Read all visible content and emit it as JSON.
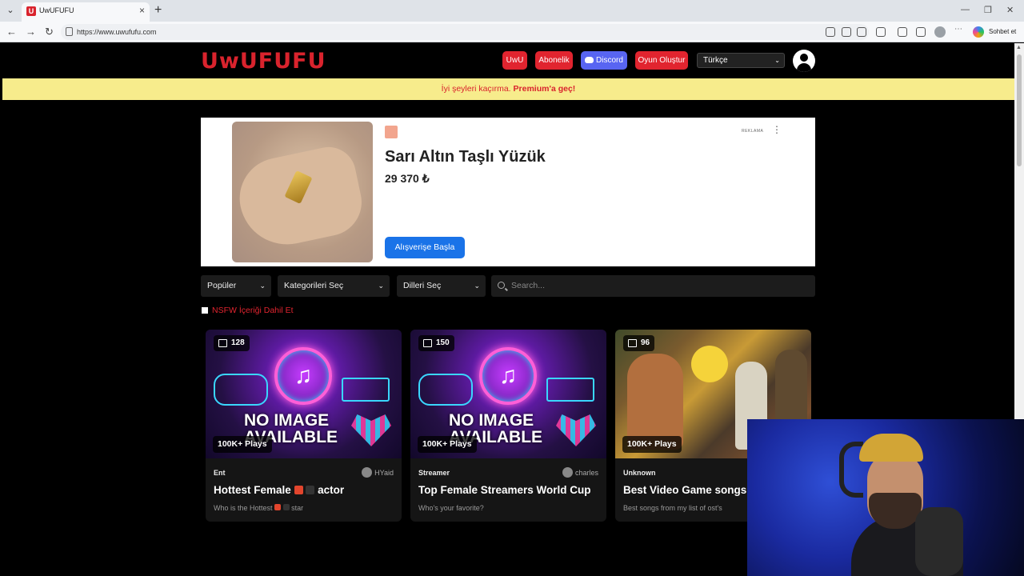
{
  "browser": {
    "tab_title": "UwUFUFU",
    "tab_favicon_letter": "U",
    "url": "https://www.uwufufu.com",
    "copilot_label": "Sohbet et"
  },
  "header": {
    "logo": "UwUFUFU",
    "buttons": {
      "uwu": "UwU",
      "subscription": "Abonelik",
      "discord": "Discord",
      "create_game": "Oyun Oluştur"
    },
    "language": "Türkçe"
  },
  "promo": {
    "text": "İyi şeyleri kaçırma.",
    "link": "Premium'a geç!"
  },
  "ad": {
    "label": "REKLAMA",
    "title": "Sarı Altın Taşlı Yüzük",
    "price": "29 370 ₺",
    "cta": "Alışverişe Başla"
  },
  "filters": {
    "sort": "Popüler",
    "category": "Kategorileri Seç",
    "languages": "Dilleri Seç",
    "search_placeholder": "Search...",
    "nsfw_label": "NSFW İçeriği Dahil Et"
  },
  "cards": [
    {
      "count": "128",
      "plays": "100K+ Plays",
      "image_text": "NO IMAGE AVAILABLE",
      "category": "Ent",
      "author": "HYaid",
      "title_pre": "Hottest Female",
      "title_post": "actor",
      "desc_pre": "Who is the Hottest",
      "desc_post": "star"
    },
    {
      "count": "150",
      "plays": "100K+ Plays",
      "image_text": "NO IMAGE AVAILABLE",
      "category": "Streamer",
      "author": "charles",
      "title": "Top Female Streamers World Cup",
      "desc": "Who's your favorite?"
    },
    {
      "count": "96",
      "plays": "100K+ Plays",
      "category": "Unknown",
      "author": "",
      "title": "Best Video Game songs",
      "desc": "Best songs from my list of ost's"
    }
  ],
  "colors": {
    "brand_red": "#e1242f",
    "promo_bg": "#f7ec8c",
    "discord": "#5865f2",
    "ad_cta": "#1a73e8"
  }
}
